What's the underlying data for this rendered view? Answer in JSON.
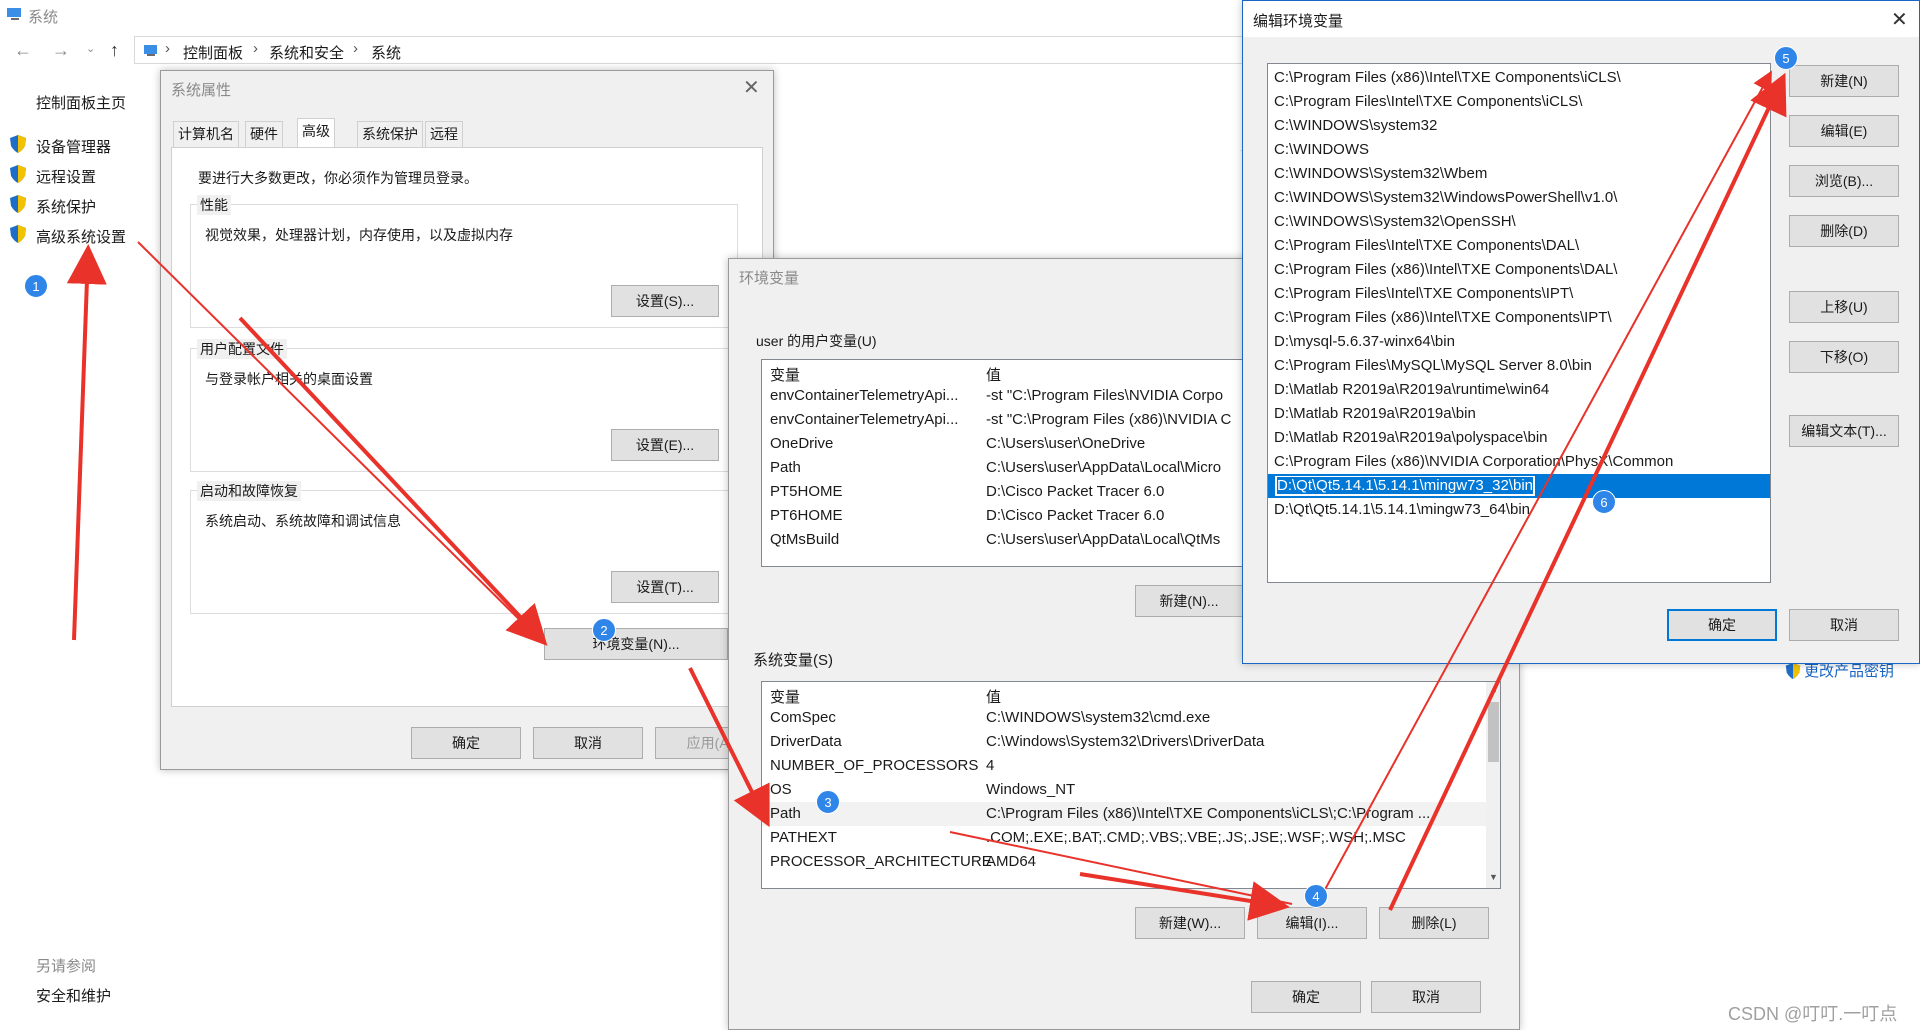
{
  "control_panel": {
    "title": "系统",
    "breadcrumb": [
      "控制面板",
      "系统和安全",
      "系统"
    ],
    "home_link": "控制面板主页",
    "side_links": [
      "设备管理器",
      "远程设置",
      "系统保护",
      "高级系统设置"
    ],
    "see_also": "另请参阅",
    "security_link": "安全和维护",
    "change_key_link": "更改产品密钥"
  },
  "system_properties": {
    "title": "系统属性",
    "tabs": [
      "计算机名",
      "硬件",
      "高级",
      "系统保护",
      "远程"
    ],
    "active_tab": "高级",
    "admin_note": "要进行大多数更改，你必须作为管理员登录。",
    "groups": [
      {
        "title": "性能",
        "desc": "视觉效果，处理器计划，内存使用，以及虚拟内存",
        "button": "设置(S)..."
      },
      {
        "title": "用户配置文件",
        "desc": "与登录帐户相关的桌面设置",
        "button": "设置(E)..."
      },
      {
        "title": "启动和故障恢复",
        "desc": "系统启动、系统故障和调试信息",
        "button": "设置(T)..."
      }
    ],
    "env_button": "环境变量(N)...",
    "ok": "确定",
    "cancel": "取消",
    "apply": "应用(A)"
  },
  "env_vars": {
    "title": "环境变量",
    "user_group": "user 的用户变量(U)",
    "user_headers": [
      "变量",
      "值"
    ],
    "user_rows": [
      [
        "envContainerTelemetryApi...",
        "-st \"C:\\Program Files\\NVIDIA Corpo"
      ],
      [
        "envContainerTelemetryApi...",
        "-st \"C:\\Program Files (x86)\\NVIDIA C"
      ],
      [
        "OneDrive",
        "C:\\Users\\user\\OneDrive"
      ],
      [
        "Path",
        "C:\\Users\\user\\AppData\\Local\\Micro"
      ],
      [
        "PT5HOME",
        "D:\\Cisco Packet Tracer 6.0"
      ],
      [
        "PT6HOME",
        "D:\\Cisco Packet Tracer 6.0"
      ],
      [
        "QtMsBuild",
        "C:\\Users\\user\\AppData\\Local\\QtMs"
      ]
    ],
    "user_new": "新建(N)...",
    "sys_group": "系统变量(S)",
    "sys_headers": [
      "变量",
      "值"
    ],
    "sys_rows": [
      [
        "ComSpec",
        "C:\\WINDOWS\\system32\\cmd.exe"
      ],
      [
        "DriverData",
        "C:\\Windows\\System32\\Drivers\\DriverData"
      ],
      [
        "NUMBER_OF_PROCESSORS",
        "4"
      ],
      [
        "OS",
        "Windows_NT"
      ],
      [
        "Path",
        "C:\\Program Files (x86)\\Intel\\TXE Components\\iCLS\\;C:\\Program ..."
      ],
      [
        "PATHEXT",
        ".COM;.EXE;.BAT;.CMD;.VBS;.VBE;.JS;.JSE;.WSF;.WSH;.MSC"
      ],
      [
        "PROCESSOR_ARCHITECTURE",
        "AMD64"
      ]
    ],
    "sys_new": "新建(W)...",
    "sys_edit": "编辑(I)...",
    "sys_delete": "删除(L)",
    "ok": "确定",
    "cancel": "取消"
  },
  "edit_env": {
    "title": "编辑环境变量",
    "paths": [
      "C:\\Program Files (x86)\\Intel\\TXE Components\\iCLS\\",
      "C:\\Program Files\\Intel\\TXE Components\\iCLS\\",
      "C:\\WINDOWS\\system32",
      "C:\\WINDOWS",
      "C:\\WINDOWS\\System32\\Wbem",
      "C:\\WINDOWS\\System32\\WindowsPowerShell\\v1.0\\",
      "C:\\WINDOWS\\System32\\OpenSSH\\",
      "C:\\Program Files\\Intel\\TXE Components\\DAL\\",
      "C:\\Program Files (x86)\\Intel\\TXE Components\\DAL\\",
      "C:\\Program Files\\Intel\\TXE Components\\IPT\\",
      "C:\\Program Files (x86)\\Intel\\TXE Components\\IPT\\",
      "D:\\mysql-5.6.37-winx64\\bin",
      "C:\\Program Files\\MySQL\\MySQL Server 8.0\\bin",
      "D:\\Matlab R2019a\\R2019a\\runtime\\win64",
      "D:\\Matlab R2019a\\R2019a\\bin",
      "D:\\Matlab R2019a\\R2019a\\polyspace\\bin",
      "C:\\Program Files (x86)\\NVIDIA Corporation\\PhysX\\Common",
      "D:\\Qt\\Qt5.14.1\\5.14.1\\mingw73_32\\bin",
      "D:\\Qt\\Qt5.14.1\\5.14.1\\mingw73_64\\bin"
    ],
    "selected_index": 17,
    "buttons": [
      "新建(N)",
      "编辑(E)",
      "浏览(B)...",
      "删除(D)",
      "上移(U)",
      "下移(O)",
      "编辑文本(T)..."
    ],
    "ok": "确定",
    "cancel": "取消"
  },
  "badges": [
    "1",
    "2",
    "3",
    "4",
    "5",
    "6"
  ],
  "annotation_color": "#e8322a",
  "watermark": "CSDN @叮叮.一叮点"
}
